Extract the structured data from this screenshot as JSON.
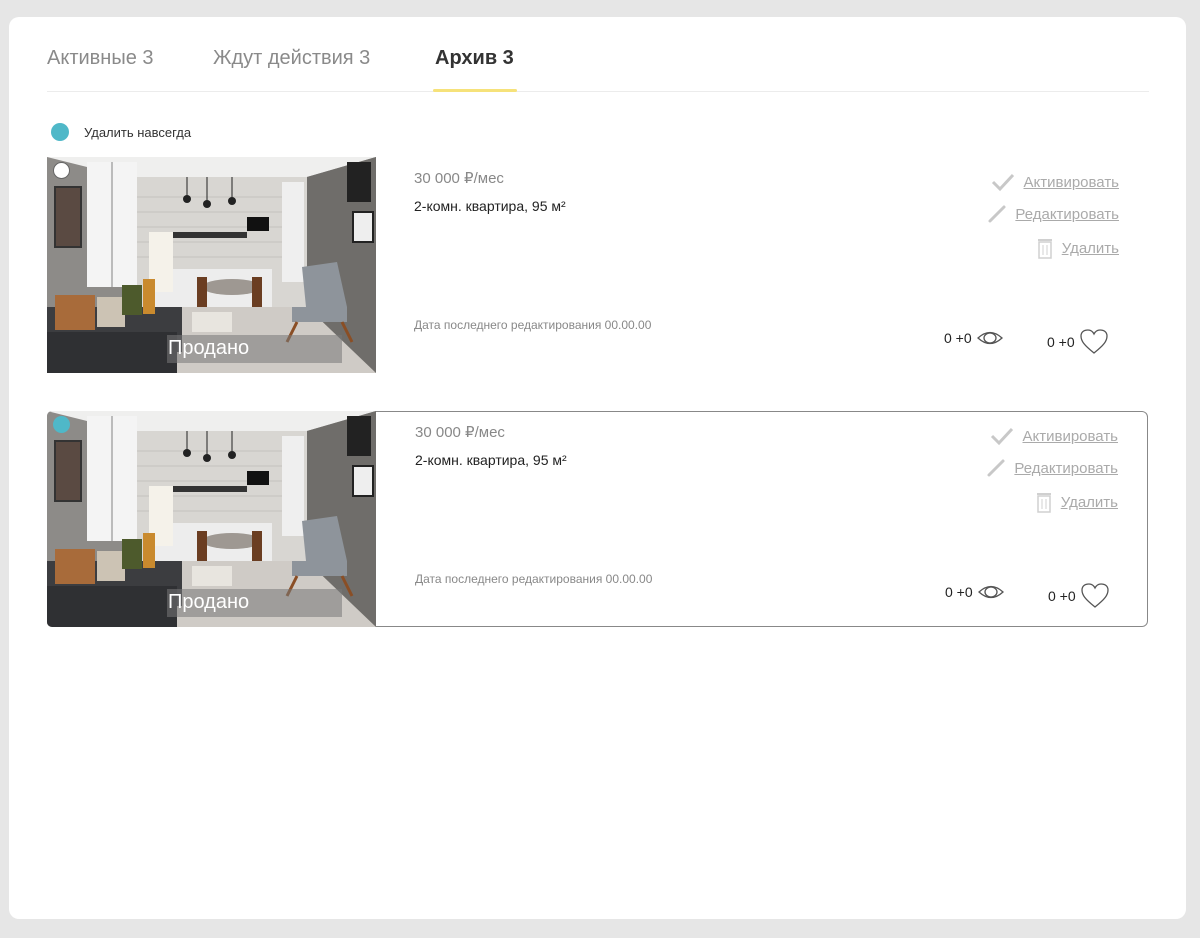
{
  "tabs": [
    {
      "label": "Активные 3",
      "active": false
    },
    {
      "label": "Ждут действия 3",
      "active": false
    },
    {
      "label": "Архив 3",
      "active": true
    }
  ],
  "bulk_action": {
    "label": "Удалить навсегда"
  },
  "listings": [
    {
      "status_label": "Продано",
      "selected": false,
      "price": "30 000 ₽/мес",
      "title": "2-комн. квартира, 95 м²",
      "last_edited": "Дата последнего редактирования 00.00.00",
      "actions": {
        "activate": "Активировать",
        "edit": "Редактировать",
        "delete": "Удалить"
      },
      "views": "0 +0",
      "favorites": "0 +0"
    },
    {
      "status_label": "Продано",
      "selected": true,
      "price": "30 000 ₽/мес",
      "title": "2-комн. квартира, 95 м²",
      "last_edited": "Дата последнего редактирования 00.00.00",
      "actions": {
        "activate": "Активировать",
        "edit": "Редактировать",
        "delete": "Удалить"
      },
      "views": "0 +0",
      "favorites": "0 +0"
    }
  ],
  "colors": {
    "accent_teal": "#4fb8c8",
    "tab_underline": "#f6e27a"
  },
  "icons": [
    "check-icon",
    "pencil-icon",
    "trash-icon",
    "eye-icon",
    "heart-icon"
  ]
}
